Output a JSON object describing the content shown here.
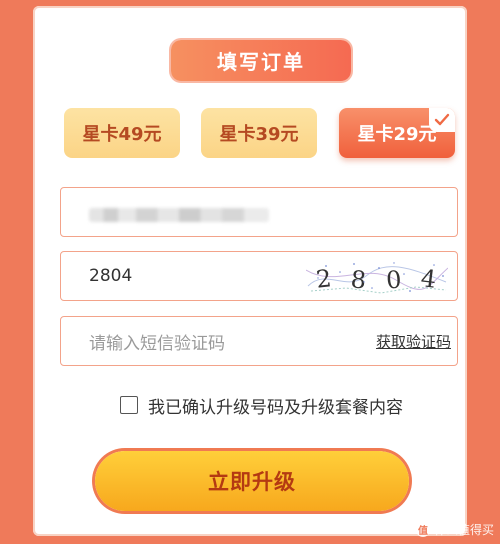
{
  "header": {
    "title": "填写订单"
  },
  "plans": [
    {
      "label": "星卡49元",
      "selected": false
    },
    {
      "label": "星卡39元",
      "selected": false
    },
    {
      "label": "星卡29元",
      "selected": true
    }
  ],
  "phone_field": {
    "value": ""
  },
  "captcha_field": {
    "value": "2804",
    "captcha_chars": [
      "2",
      "8",
      "0",
      "4"
    ]
  },
  "sms_field": {
    "placeholder": "请输入短信验证码",
    "link_label": "获取验证码"
  },
  "agreement": {
    "label": "我已确认升级号码及升级套餐内容",
    "checked": false
  },
  "cta": {
    "label": "立即升级"
  },
  "watermark": {
    "text": "什么值得买",
    "logo_char": "值"
  },
  "colors": {
    "background": "#ef7a5a",
    "accent": "#f56a52",
    "cta": "#f7a81d",
    "border": "#f3a38a"
  }
}
